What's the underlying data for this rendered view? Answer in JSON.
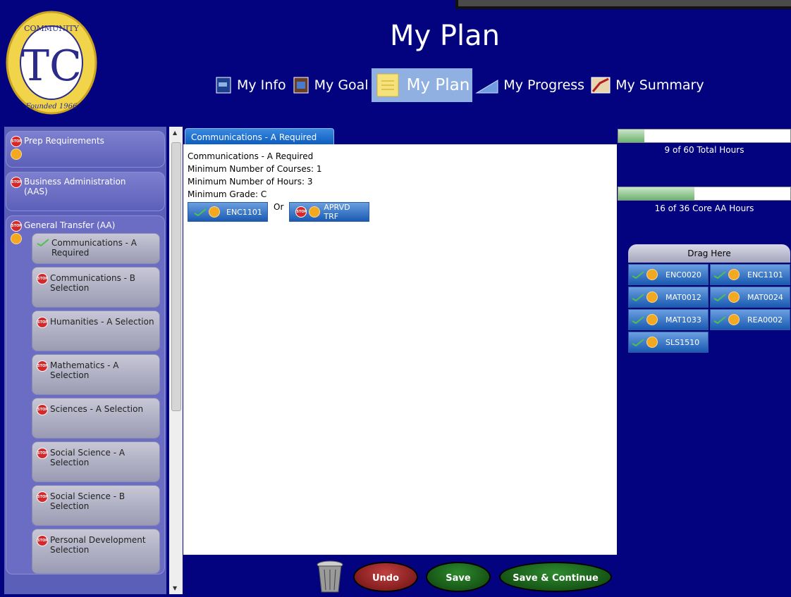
{
  "header": {
    "title": "My Plan",
    "logo_text": "TALLAHASSEE COMMUNITY COLLEGE Founded 1966"
  },
  "nav": [
    {
      "label": "My Info",
      "icon": "info-book-icon"
    },
    {
      "label": "My Goal",
      "icon": "goal-book-icon"
    },
    {
      "label": "My Plan",
      "icon": "plan-notepad-icon",
      "active": true
    },
    {
      "label": "My Progress",
      "icon": "progress-ramp-icon"
    },
    {
      "label": "My Summary",
      "icon": "summary-chart-icon"
    }
  ],
  "sidebar": {
    "groups": [
      {
        "label": "Prep Requirements",
        "status": "stop"
      },
      {
        "label": "Business Administration (AAS)",
        "status": "stop"
      },
      {
        "label": "General Transfer (AA)",
        "status": "stop"
      }
    ],
    "subitems": [
      {
        "label": "Communications - A Required",
        "status": "check"
      },
      {
        "label": "Communications - B Selection",
        "status": "stop"
      },
      {
        "label": "Humanities - A Selection",
        "status": "stop"
      },
      {
        "label": "Mathematics - A Selection",
        "status": "stop"
      },
      {
        "label": "Sciences - A Selection",
        "status": "stop"
      },
      {
        "label": "Social Science - A Selection",
        "status": "stop"
      },
      {
        "label": "Social Science - B Selection",
        "status": "stop"
      },
      {
        "label": "Personal Development Selection",
        "status": "stop"
      }
    ]
  },
  "main": {
    "tab_label": "Communications - A Required",
    "lines": [
      "Communications - A Required",
      "Minimum Number of Courses: 1",
      "Minimum Number of Hours: 3",
      "Minimum Grade: C"
    ],
    "course1": "ENC1101",
    "or_label": "Or",
    "course2": "APRVD TRF"
  },
  "right": {
    "total_hours_label": "9 of 60 Total Hours",
    "total_hours_fraction": 0.15,
    "core_hours_label": "16 of 36 Core AA Hours",
    "core_hours_fraction": 0.444,
    "drag_label": "Drag Here",
    "drag_courses": [
      "ENC0020",
      "ENC1101",
      "MAT0012",
      "MAT0024",
      "MAT1033",
      "REA0002",
      "SLS1510"
    ]
  },
  "buttons": {
    "undo": "Undo",
    "save": "Save",
    "save_continue": "Save & Continue"
  }
}
